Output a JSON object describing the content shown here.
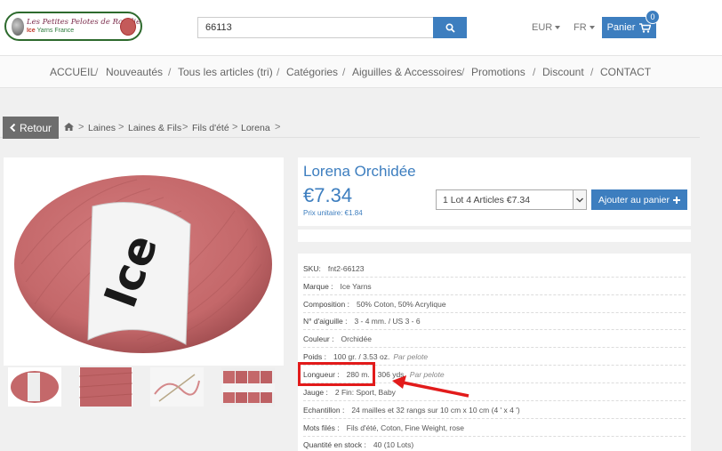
{
  "header": {
    "logo_title": "Les Petites Pelotes de Rosalie",
    "logo_sub_brand": "Ice",
    "logo_sub_rest": "Yarns France",
    "search_value": "66113",
    "currency": "EUR",
    "language": "FR",
    "cart_label": "Panier",
    "cart_count": "0"
  },
  "nav": {
    "items": [
      "ACCUEIL",
      "Nouveautés",
      "Tous les articles (tri)",
      "Catégories",
      "Aiguilles & Accessoires",
      "Promotions",
      "Discount",
      "CONTACT"
    ],
    "separator": "/"
  },
  "breadcrumb": {
    "back_label": "Retour",
    "items": [
      "Laines",
      "Laines & Fils",
      "Fils d'été",
      "Lorena"
    ],
    "separator": ">"
  },
  "product": {
    "title": "Lorena Orchidée",
    "price": "€7.34",
    "unit_price": "Prix unitaire: €1.84",
    "lot_option": "1 Lot 4 Articles €7.34",
    "add_to_cart": "Ajouter au panier"
  },
  "gallery": {
    "brand_text": "Ice",
    "yarn_color": "#c4686a"
  },
  "details": {
    "sku_label": "SKU:",
    "sku_value": "fnt2-66123",
    "brand_label": "Marque :",
    "brand_value": "Ice Yarns",
    "composition_label": "Composition :",
    "composition_value": "50% Coton, 50% Acrylique",
    "needle_label": "N° d'aiguille :",
    "needle_value": "3 - 4 mm. / US 3 - 6",
    "color_label": "Couleur :",
    "color_value": "Orchidée",
    "weight_label": "Poids :",
    "weight_value": "100 gr. / 3.53 oz.",
    "weight_note": "Par pelote",
    "length_label": "Longueur :",
    "length_value": "280 m.",
    "length_yds": "306 yds.",
    "length_note": "Par pelote",
    "gauge_label": "Jauge :",
    "gauge_value": "2 Fin: Sport, Baby",
    "sample_label": "Echantillon :",
    "sample_value": "24 mailles et 32 rangs sur 10 cm x 10 cm (4 ' x 4 ')",
    "keywords_label": "Mots filés :",
    "keywords_value": "Fils d'été, Coton, Fine Weight, rose",
    "stock_label": "Quantité en stock :",
    "stock_value": "40 (10 Lots)"
  },
  "colors": {
    "accent": "#3d7ebf",
    "highlight": "#e21b1b"
  }
}
